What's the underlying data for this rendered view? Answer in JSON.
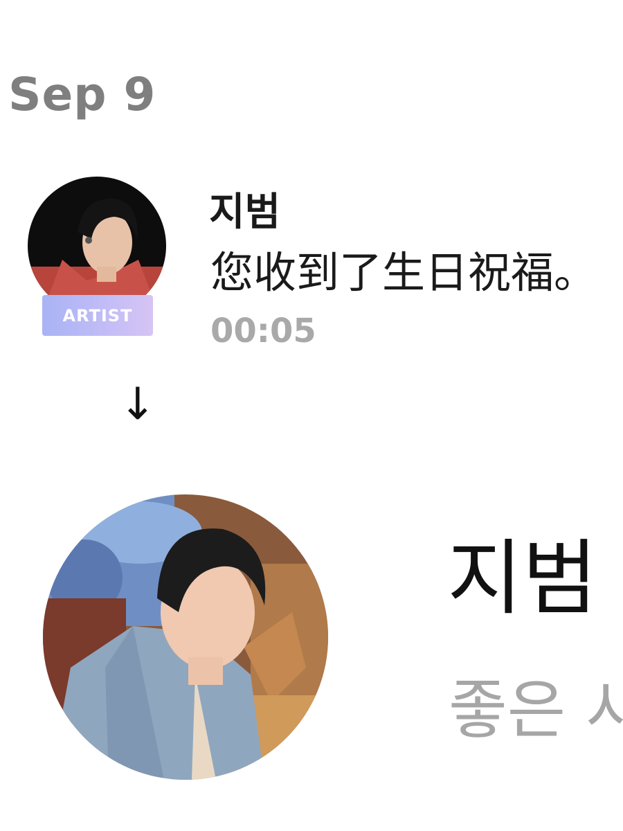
{
  "feed": {
    "date_header": "Sep 9",
    "notification": {
      "sender_name": "지범",
      "badge_label": "ARTIST",
      "message": "您收到了生日祝福。",
      "time": "00:05",
      "avatar_icon": "artist-profile-photo"
    }
  },
  "transition": {
    "arrow_symbol": "↓"
  },
  "profile": {
    "name": "지범",
    "status_message": "좋은 사",
    "avatar_icon": "profile-photo"
  },
  "colors": {
    "date_gray": "#7f7f7f",
    "time_gray": "#a9a9a9",
    "badge_gradient_start": "#a9b3f5",
    "badge_gradient_end": "#d6c4f4",
    "status_gray": "#a6a6a6"
  }
}
